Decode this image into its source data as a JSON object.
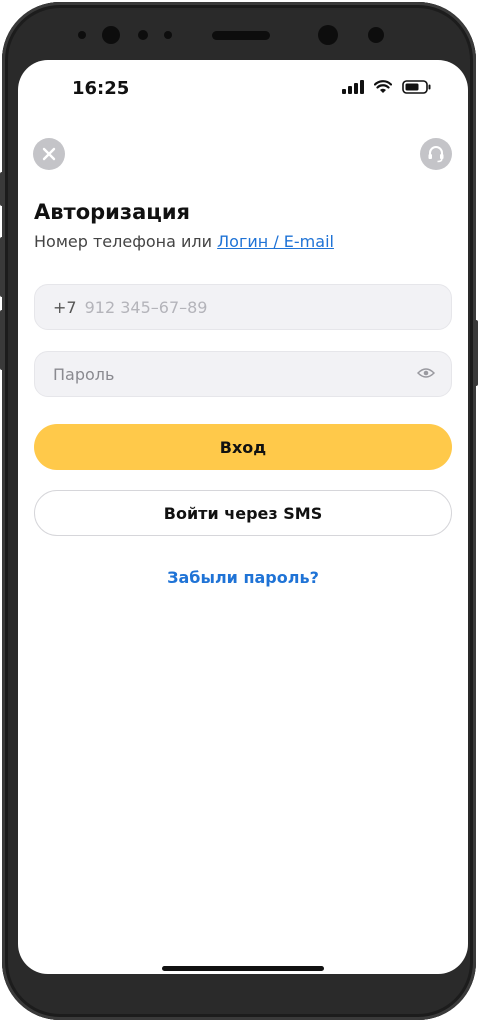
{
  "status_bar": {
    "time": "16:25",
    "icons": [
      "cellular-signal-icon",
      "wifi-icon",
      "battery-icon"
    ]
  },
  "header": {
    "close_icon": "close-icon",
    "support_icon": "headset-icon"
  },
  "auth": {
    "title": "Авторизация",
    "subtitle_prefix": "Номер телефона или ",
    "subtitle_link": "Логин / E-mail",
    "phone_prefix": "+7",
    "phone_placeholder": "912 345–67–89",
    "password_placeholder": "Пароль",
    "login_button": "Вход",
    "sms_button": "Войти через SMS",
    "forgot_password": "Забыли пароль?"
  },
  "colors": {
    "accent": "#ffc94a",
    "link": "#1f73d6",
    "field_bg": "#f2f2f5"
  }
}
